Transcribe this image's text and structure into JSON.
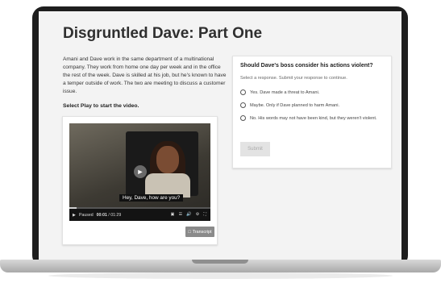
{
  "page": {
    "title": "Disgruntled Dave: Part One",
    "intro": "Amani and Dave work in the same department of a multinational company. They work from home one day per week and in the office the rest of the week. Dave is skilled at his job, but he's known to have a temper outside of work. The two are meeting to discuss a customer issue.",
    "play_hint": "Select Play to start the video."
  },
  "video": {
    "caption": "Hey, Dave, how are you?",
    "state_label": "Paused",
    "time_current": "00:01",
    "time_total": "01:29",
    "progress": 0.05,
    "transcript_label": "Transcript",
    "icons": [
      "play-icon",
      "captions-icon",
      "chapters-icon",
      "volume-icon",
      "settings-icon",
      "fullscreen-icon",
      "transcript-icon"
    ]
  },
  "question": {
    "title": "Should Dave's boss consider his actions violent?",
    "instruction": "Select a response. Submit your response to continue.",
    "options": [
      "Yes. Dave made a threat to Amani.",
      "Maybe. Only if Dave planned to harm Amani.",
      "No. His words may not have been kind, but they weren't violent."
    ],
    "submit_label": "Submit"
  }
}
